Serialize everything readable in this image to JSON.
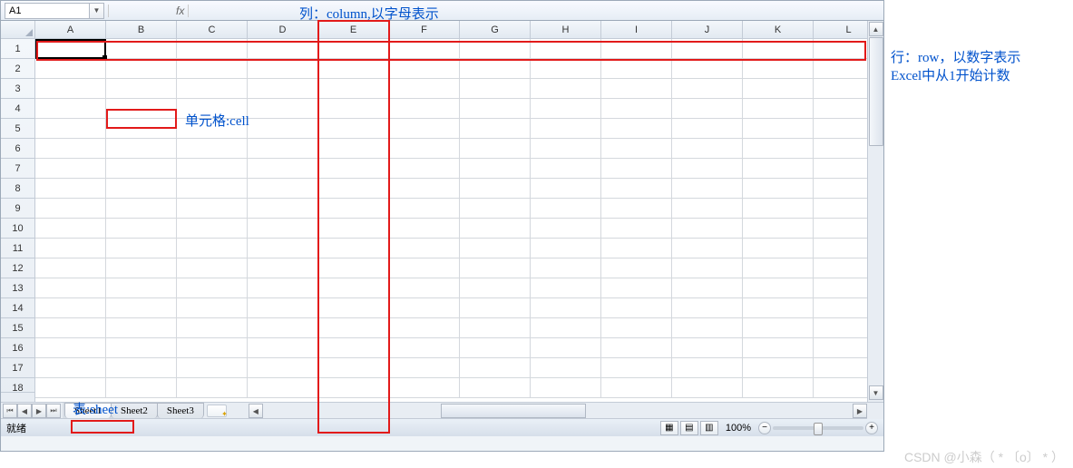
{
  "nameBox": "A1",
  "columns": [
    "A",
    "B",
    "C",
    "D",
    "E",
    "F",
    "G",
    "H",
    "I",
    "J",
    "K",
    "L"
  ],
  "rows": [
    "1",
    "2",
    "3",
    "4",
    "5",
    "6",
    "7",
    "8",
    "9",
    "10",
    "11",
    "12",
    "13",
    "14",
    "15",
    "16",
    "17",
    "18"
  ],
  "sheets": {
    "active": "Sheet1",
    "tabs": [
      "Sheet1",
      "Sheet2",
      "Sheet3"
    ]
  },
  "status": {
    "ready": "就绪",
    "zoom": "100%"
  },
  "annotations": {
    "column": "列：column,以字母表示",
    "row_line1": "行：row，以数字表示",
    "row_line2": "Excel中从1开始计数",
    "cell": "单元格:cell",
    "sheet": "表:sheet"
  },
  "watermark": "CSDN @小森（ * 〔o〕 * ）",
  "icons": {
    "fx": "fx"
  }
}
